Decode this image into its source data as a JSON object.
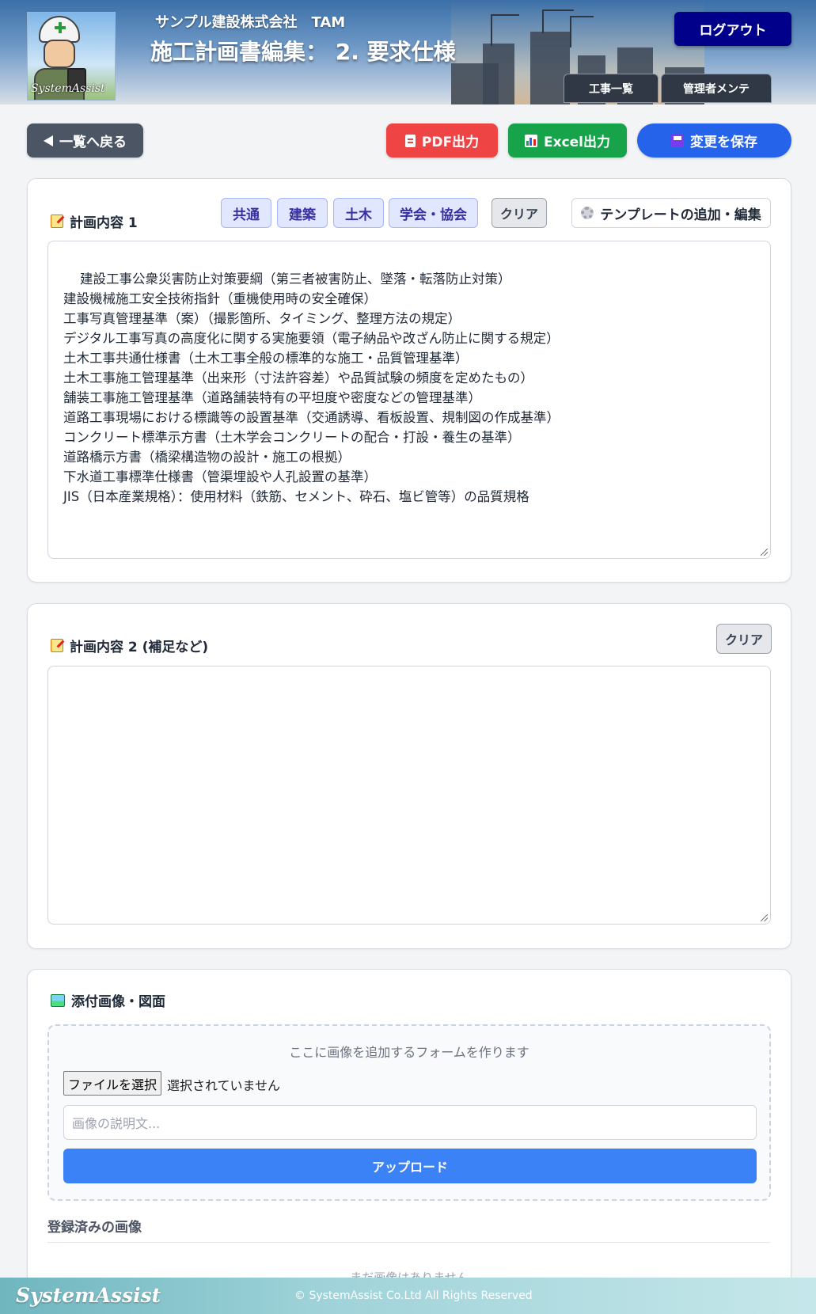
{
  "header": {
    "company": "サンプル建設株式会社　TAM",
    "title": "施工計画書編集： 2. 要求仕様",
    "avatar_signature": "SystemAssist",
    "logout_label": "ログアウト",
    "nav_tabs": [
      "工事一覧",
      "管理者メンテ"
    ]
  },
  "toolbar": {
    "back_label": "一覧へ戻る",
    "pdf_label": "PDF出力",
    "excel_label": "Excel出力",
    "save_label": "変更を保存"
  },
  "section1": {
    "title": "計画内容 1",
    "chips": [
      "共通",
      "建築",
      "土木",
      "学会・協会"
    ],
    "clear_label": "クリア",
    "template_label": "テンプレートの追加・編集",
    "content": "建設工事公衆災害防止対策要綱（第三者被害防止、墜落・転落防止対策）\n建設機械施工安全技術指針（重機使用時の安全確保）\n工事写真管理基準（案）（撮影箇所、タイミング、整理方法の規定）\nデジタル工事写真の高度化に関する実施要領（電子納品や改ざん防止に関する規定）\n土木工事共通仕様書（土木工事全般の標準的な施工・品質管理基準）\n土木工事施工管理基準（出来形（寸法許容差）や品質試験の頻度を定めたもの）\n舗装工事施工管理基準（道路舗装特有の平坦度や密度などの管理基準）\n道路工事現場における標識等の設置基準（交通誘導、看板設置、規制図の作成基準）\nコンクリート標準示方書（土木学会コンクリートの配合・打設・養生の基準）\n道路橋示方書（橋梁構造物の設計・施工の根拠）\n下水道工事標準仕様書（管渠埋設や人孔設置の基準）\nJIS（日本産業規格）：使用材料（鉄筋、セメント、砕石、塩ビ管等）の品質規格"
  },
  "section2": {
    "title": "計画内容 2 (補足など)",
    "clear_label": "クリア",
    "content": ""
  },
  "attachments": {
    "title": "添付画像・図面",
    "dropzone_text": "ここに画像を追加するフォームを作ります",
    "file_button": "ファイルを選択",
    "file_none": "選択されていません",
    "description_placeholder": "画像の説明文...",
    "upload_label": "アップロード",
    "registered_title": "登録済みの画像",
    "empty_text": "まだ画像はありません"
  },
  "footer": {
    "logo": "SystemAssist",
    "copyright": "© SystemAssist Co.Ltd All Rights Reserved"
  },
  "colors": {
    "logout": "#00008b",
    "back": "#4b5563",
    "pdf": "#ef4444",
    "excel": "#16a34a",
    "save": "#2563eb",
    "upload": "#3b82f6"
  }
}
